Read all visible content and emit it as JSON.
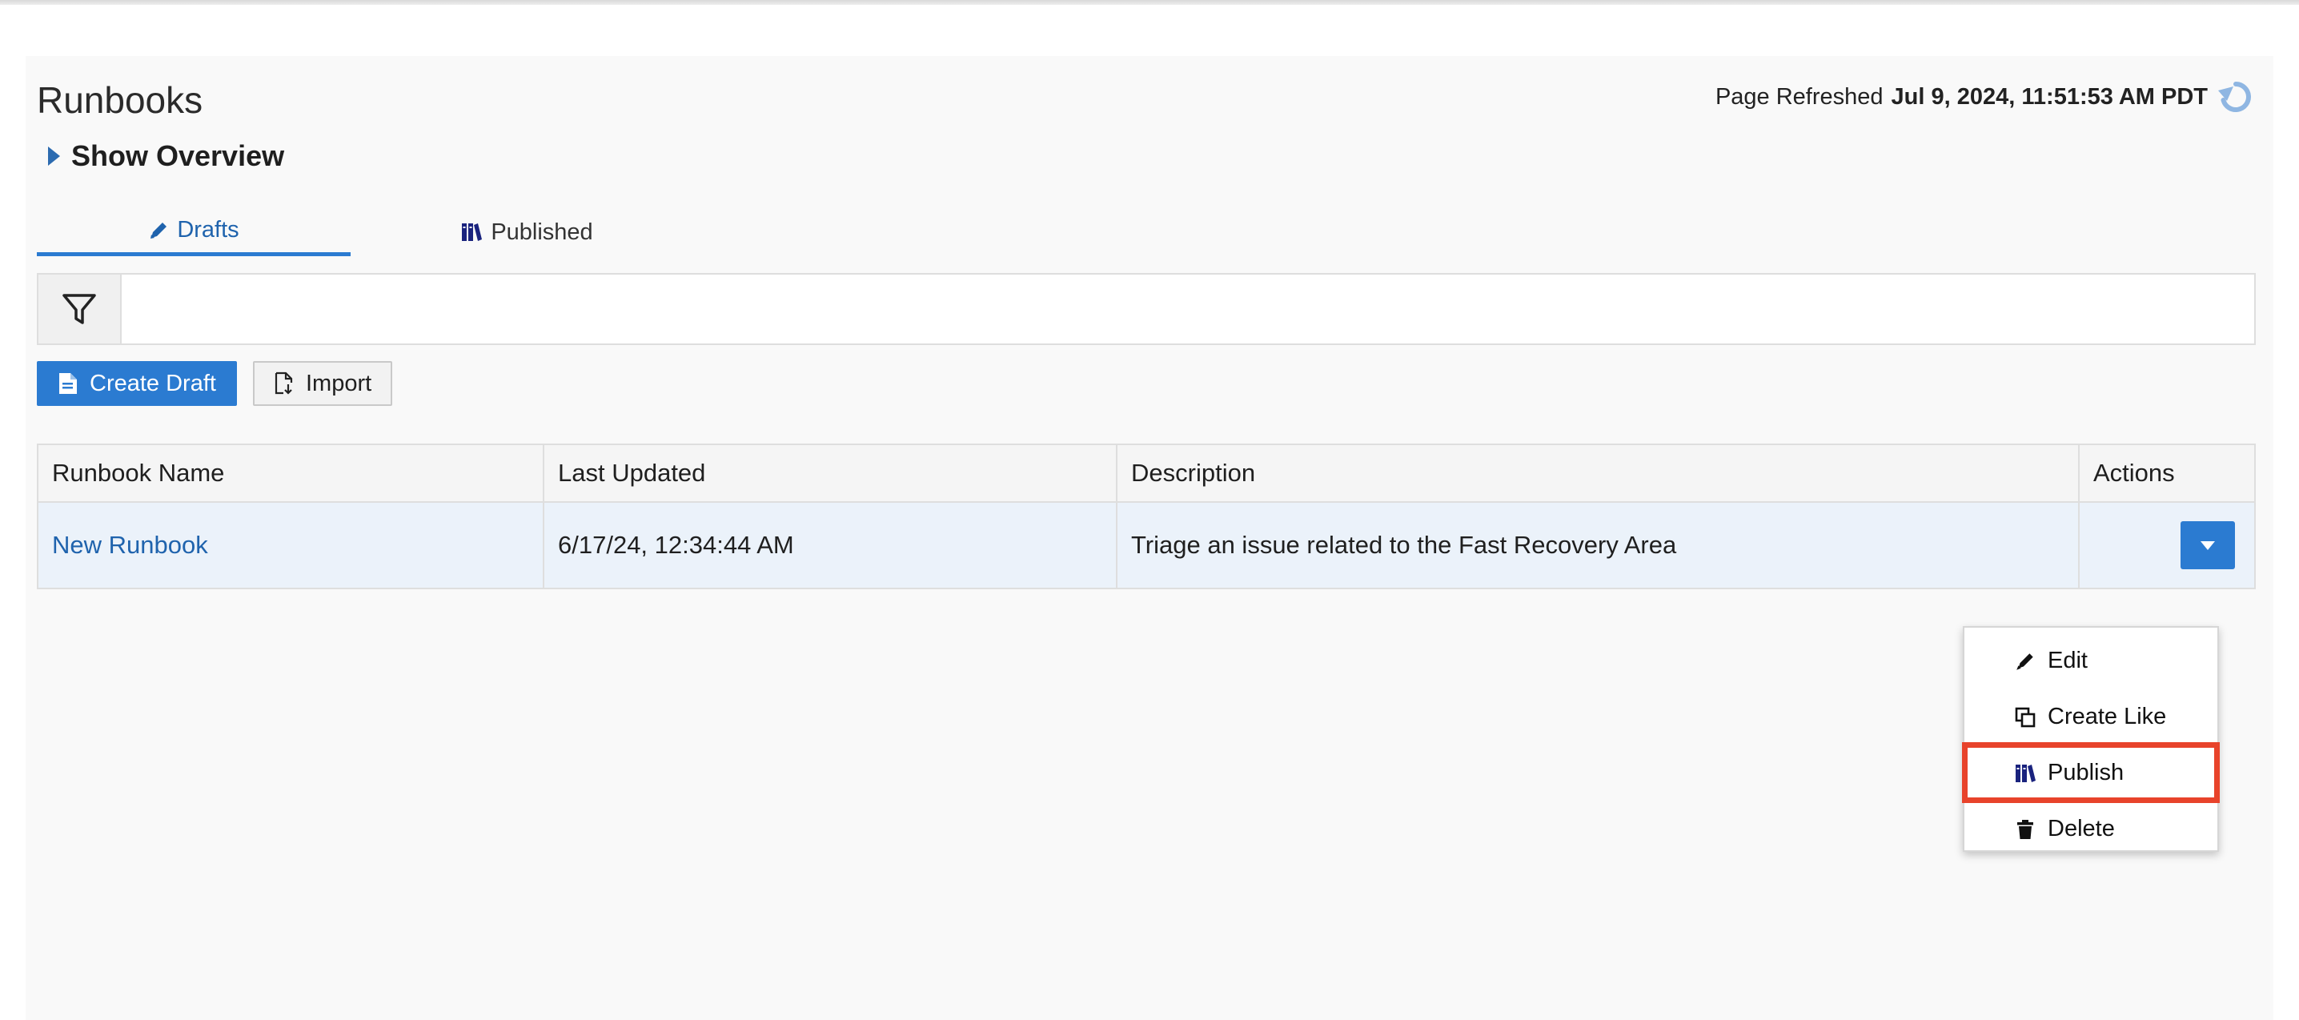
{
  "header": {
    "title": "Runbooks",
    "refresh_label": "Page Refreshed",
    "refresh_time": "Jul 9, 2024, 11:51:53 AM PDT"
  },
  "overview": {
    "label": "Show Overview"
  },
  "tabs": [
    {
      "label": "Drafts",
      "icon": "pencil-icon",
      "active": true
    },
    {
      "label": "Published",
      "icon": "books-icon",
      "active": false
    }
  ],
  "toolbar": {
    "create_label": "Create Draft",
    "import_label": "Import"
  },
  "table": {
    "columns": [
      "Runbook Name",
      "Last Updated",
      "Description",
      "Actions"
    ],
    "rows": [
      {
        "name": "New Runbook",
        "updated": "6/17/24, 12:34:44 AM",
        "description": "Triage an issue related to the Fast Recovery Area"
      }
    ]
  },
  "actions_menu": {
    "items": [
      {
        "label": "Edit",
        "icon": "pencil-icon"
      },
      {
        "label": "Create Like",
        "icon": "copy-icon"
      },
      {
        "label": "Publish",
        "icon": "books-icon",
        "highlighted": true
      },
      {
        "label": "Delete",
        "icon": "trash-icon"
      }
    ]
  },
  "colors": {
    "accent": "#2b7bd1",
    "link": "#1f63ad",
    "row_highlight": "#ebf2fa",
    "callout": "#e8432b",
    "books_icon": "#1a237e"
  }
}
